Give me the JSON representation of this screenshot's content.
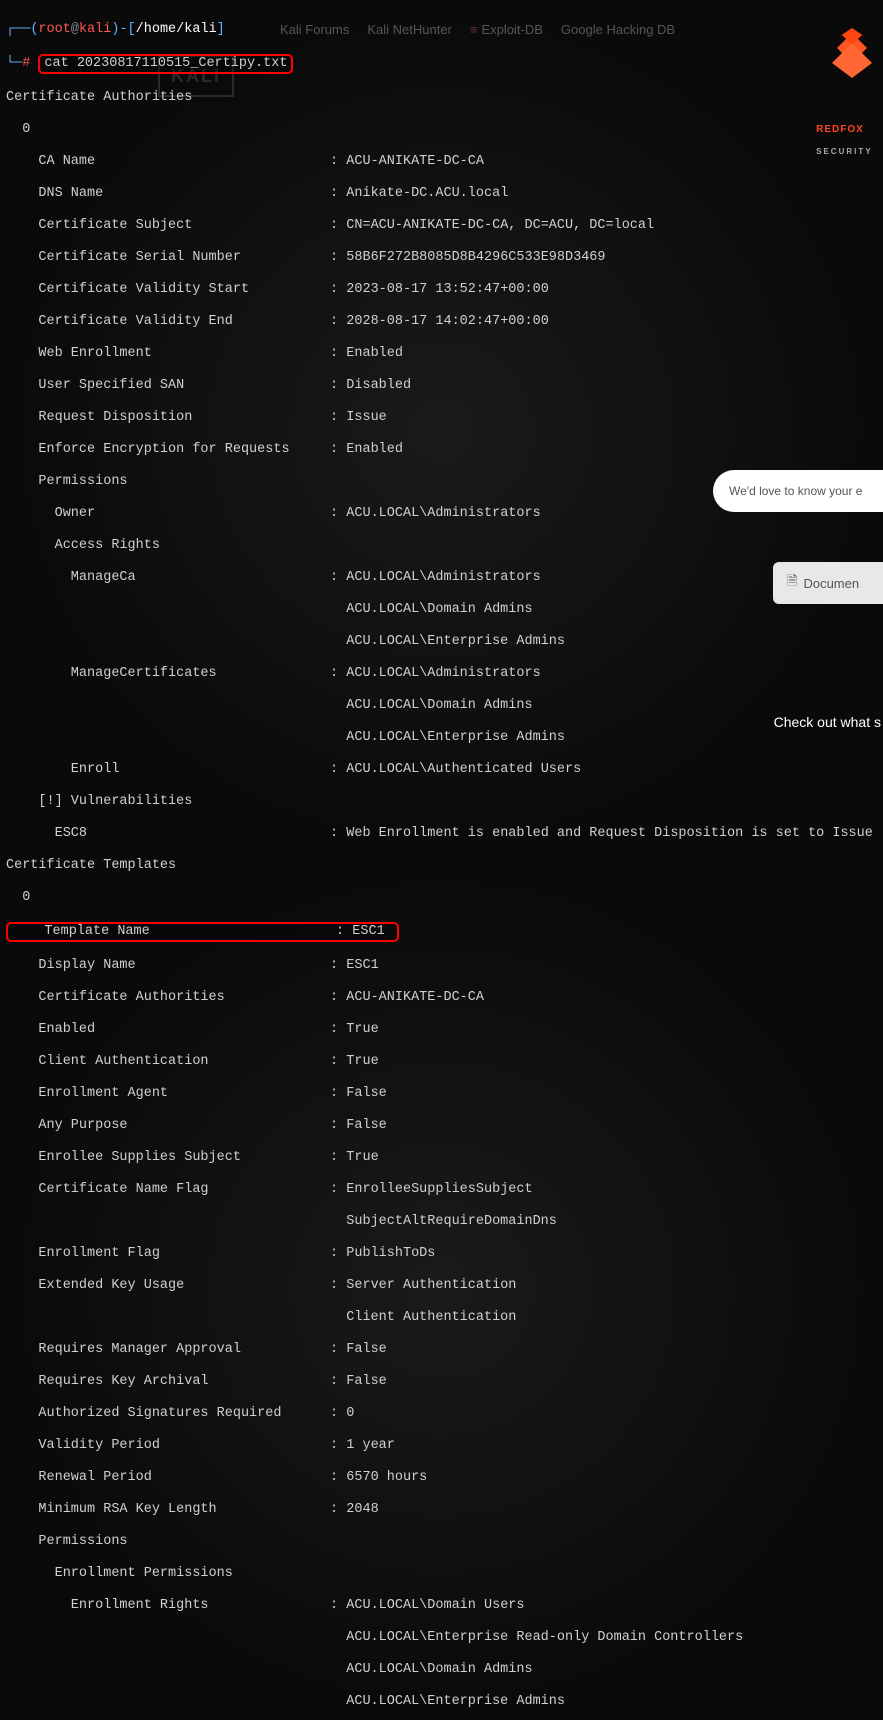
{
  "bookmarks": {
    "forums": "Kali Forums",
    "nethunter": "Kali NetHunter",
    "exploitdb": "Exploit-DB",
    "ghdb": "Google Hacking DB"
  },
  "watermark": "KALI",
  "logo": {
    "top": "REDFOX",
    "bottom": "SECURITY"
  },
  "prompt": {
    "user": "root",
    "at": "@",
    "host": "kali",
    "lp": "(",
    "rp": ")-[",
    "path": "/home/kali",
    "rb": "]",
    "hash": "#"
  },
  "command": "cat 20230817110515_Certipy.txt",
  "lines": {
    "sec1": "Certificate Authorities",
    "n0": "  0",
    "ca_name_k": "    CA Name                             : ",
    "ca_name_v": "ACU-ANIKATE-DC-CA",
    "dns_name_k": "    DNS Name                            : ",
    "dns_name_v": "Anikate-DC.ACU.local",
    "cert_subj_k": "    Certificate Subject                 : ",
    "cert_subj_v": "CN=ACU-ANIKATE-DC-CA, DC=ACU, DC=local",
    "cert_sn_k": "    Certificate Serial Number           : ",
    "cert_sn_v": "58B6F272B8085D8B4296C533E98D3469",
    "cert_vs_k": "    Certificate Validity Start          : ",
    "cert_vs_v": "2023-08-17 13:52:47+00:00",
    "cert_ve_k": "    Certificate Validity End            : ",
    "cert_ve_v": "2028-08-17 14:02:47+00:00",
    "web_enr_k": "    Web Enrollment                      : ",
    "web_enr_v": "Enabled",
    "user_san_k": "    User Specified SAN                  : ",
    "user_san_v": "Disabled",
    "req_disp_k": "    Request Disposition                 : ",
    "req_disp_v": "Issue",
    "enf_enc_k": "    Enforce Encryption for Requests     : ",
    "enf_enc_v": "Enabled",
    "perm": "    Permissions",
    "owner_k": "      Owner                             : ",
    "owner_v": "ACU.LOCAL\\Administrators",
    "access": "      Access Rights",
    "mca_k": "        ManageCa                        : ",
    "mca_v1": "ACU.LOCAL\\Administrators",
    "mca_v2": "                                          ACU.LOCAL\\Domain Admins",
    "mca_v3": "                                          ACU.LOCAL\\Enterprise Admins",
    "mcert_k": "        ManageCertificates              : ",
    "mcert_v1": "ACU.LOCAL\\Administrators",
    "mcert_v2": "                                          ACU.LOCAL\\Domain Admins",
    "mcert_v3": "                                          ACU.LOCAL\\Enterprise Admins",
    "enroll_k": "        Enroll                          : ",
    "enroll_v": "ACU.LOCAL\\Authenticated Users",
    "vuln": "    [!] Vulnerabilities",
    "esc8_k": "      ESC8                              : ",
    "esc8_v": "Web Enrollment is enabled and Request Disposition is set to Issue",
    "sec2": "Certificate Templates",
    "n0b": "  0",
    "tmpl_name_k": "    Template Name                       : ",
    "tmpl_name_v": "ESC1",
    "disp_name_k": "    Display Name                        : ",
    "disp_name_v": "ESC1",
    "tmpl_ca_k": "    Certificate Authorities             : ",
    "tmpl_ca_v": "ACU-ANIKATE-DC-CA",
    "enab_k": "    Enabled                             : ",
    "enab_v": "True",
    "cauth_k": "    Client Authentication               : ",
    "cauth_v": "True",
    "eagent_k": "    Enrollment Agent                    : ",
    "eagent_v": "False",
    "anyp_k": "    Any Purpose                         : ",
    "anyp_v": "False",
    "esupp_k": "    Enrollee Supplies Subject           : ",
    "esupp_v": "True",
    "cnflag_k": "    Certificate Name Flag               : ",
    "cnflag_v1": "EnrolleeSuppliesSubject",
    "cnflag_v2": "                                          SubjectAltRequireDomainDns",
    "eflag_k": "    Enrollment Flag                     : ",
    "eflag_v": "PublishToDs",
    "eku_k": "    Extended Key Usage                  : ",
    "eku_v1": "Server Authentication",
    "eku_v2": "                                          Client Authentication",
    "rma_k": "    Requires Manager Approval           : ",
    "rma_v": "False",
    "rka_k": "    Requires Key Archival               : ",
    "rka_v": "False",
    "asr_k": "    Authorized Signatures Required      : ",
    "asr_v": "0",
    "vp_k": "    Validity Period                     : ",
    "vp_v": "1 year",
    "rp_k": "    Renewal Period                      : ",
    "rp_v": "6570 hours",
    "mrsa_k": "    Minimum RSA Key Length              : ",
    "mrsa_v": "2048",
    "perm2": "    Permissions",
    "eperm": "      Enrollment Permissions",
    "erights_k": "        Enrollment Rights               : ",
    "erights_v1": "ACU.LOCAL\\Domain Users",
    "erights_v2": "                                          ACU.LOCAL\\Enterprise Read-only Domain Controllers",
    "erights_v3": "                                          ACU.LOCAL\\Domain Admins",
    "erights_v4": "                                          ACU.LOCAL\\Enterprise Admins"
  },
  "widgets": {
    "chat": "We'd love to know your e",
    "doc": "Documen",
    "checkout": "Check out what s"
  }
}
